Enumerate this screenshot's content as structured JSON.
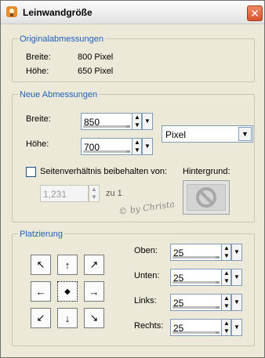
{
  "window": {
    "title": "Leinwandgröße",
    "close_label": "✕"
  },
  "original": {
    "group_title": "Originalabmessungen",
    "width_label": "Breite:",
    "width_value": "800 Pixel",
    "height_label": "Höhe:",
    "height_value": "650 Pixel"
  },
  "new_dims": {
    "group_title": "Neue Abmessungen",
    "width_label": "Breite:",
    "width_value": "850",
    "height_label": "Höhe:",
    "height_value": "700",
    "unit": "Pixel",
    "keep_ratio_label": "Seitenverhältnis beibehalten von:",
    "keep_ratio_checked": false,
    "ratio_value": "1,231",
    "ratio_suffix": "zu 1",
    "background_label": "Hintergrund:"
  },
  "placement": {
    "group_title": "Platzierung",
    "top_label": "Oben:",
    "top_value": "25",
    "bottom_label": "Unten:",
    "bottom_value": "25",
    "left_label": "Links:",
    "left_value": "25",
    "right_label": "Rechts:",
    "right_value": "25",
    "arrow_icons": [
      "arrow-up-left-icon",
      "arrow-up-icon",
      "arrow-up-right-icon",
      "arrow-left-icon",
      "center-dot-icon",
      "arrow-right-icon",
      "arrow-down-left-icon",
      "arrow-down-icon",
      "arrow-down-right-icon"
    ],
    "arrow_glyphs": [
      "↖",
      "↑",
      "↗",
      "←",
      "◆",
      "→",
      "↙",
      "↓",
      "↘"
    ]
  },
  "watermark": "© by Christa",
  "colors": {
    "group_title": "#1f5fbf",
    "close_button": "#d9522c"
  }
}
